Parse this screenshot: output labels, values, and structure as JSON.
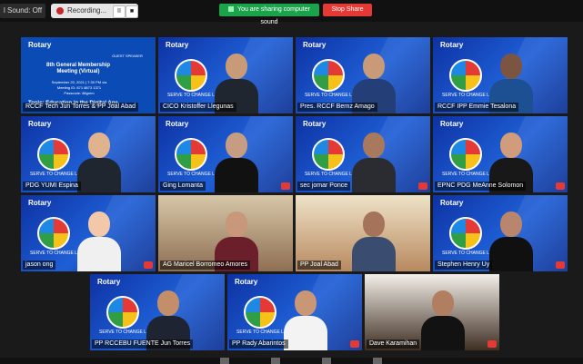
{
  "topbar": {
    "sound_label": "l Sound: Off",
    "recording_label": "Recording...",
    "pause_label": "II",
    "stop_icon": "■",
    "sharing_label": "You are sharing computer sound",
    "stop_share_label": "Stop Share"
  },
  "tiles": [
    {
      "name": "RCCF Tech",
      "subtitle": "Jun Torres & PP Joal Abad",
      "kind": "slide"
    },
    {
      "name": "CICO Kristoffer Llegunas",
      "kind": "person",
      "active": true
    },
    {
      "name": "Pres. RCCF Bernz Amago",
      "kind": "person"
    },
    {
      "name": "RCCF IPP Emmie Tesalona",
      "kind": "person"
    },
    {
      "name": "PDG YUMI Espina",
      "kind": "person"
    },
    {
      "name": "Ging Lomanta",
      "kind": "person"
    },
    {
      "name": "sec jomar Ponce",
      "kind": "person"
    },
    {
      "name": "EPNC PDG MeAnne Solomon",
      "kind": "person"
    },
    {
      "name": "jason ong",
      "kind": "person"
    },
    {
      "name": "AG Maricel Borromeo Amores",
      "kind": "photo"
    },
    {
      "name": "PP Joal Abad",
      "kind": "person"
    },
    {
      "name": "Stephen Henry Uy",
      "kind": "person"
    },
    {
      "name": "PP RCCEBU FUENTE Jun Torres",
      "kind": "person"
    },
    {
      "name": "PP Rady Abarintos",
      "kind": "person"
    },
    {
      "name": "Dave Karamihan",
      "kind": "photo"
    }
  ],
  "slide": {
    "title": "8th General Membership Meeting (Virtual)",
    "line1": "September 20, 2021 | 7:30 PM via",
    "line2": "Meeting ID: 871 8873 1371",
    "line3": "Passcode: 88gmm",
    "topic": "Topic: Education in the Digital Age",
    "guest": "GUEST SPEAKER"
  },
  "branding": {
    "rotary": "Rotary",
    "serve": "SERVE TO CHANGE LIVES"
  }
}
